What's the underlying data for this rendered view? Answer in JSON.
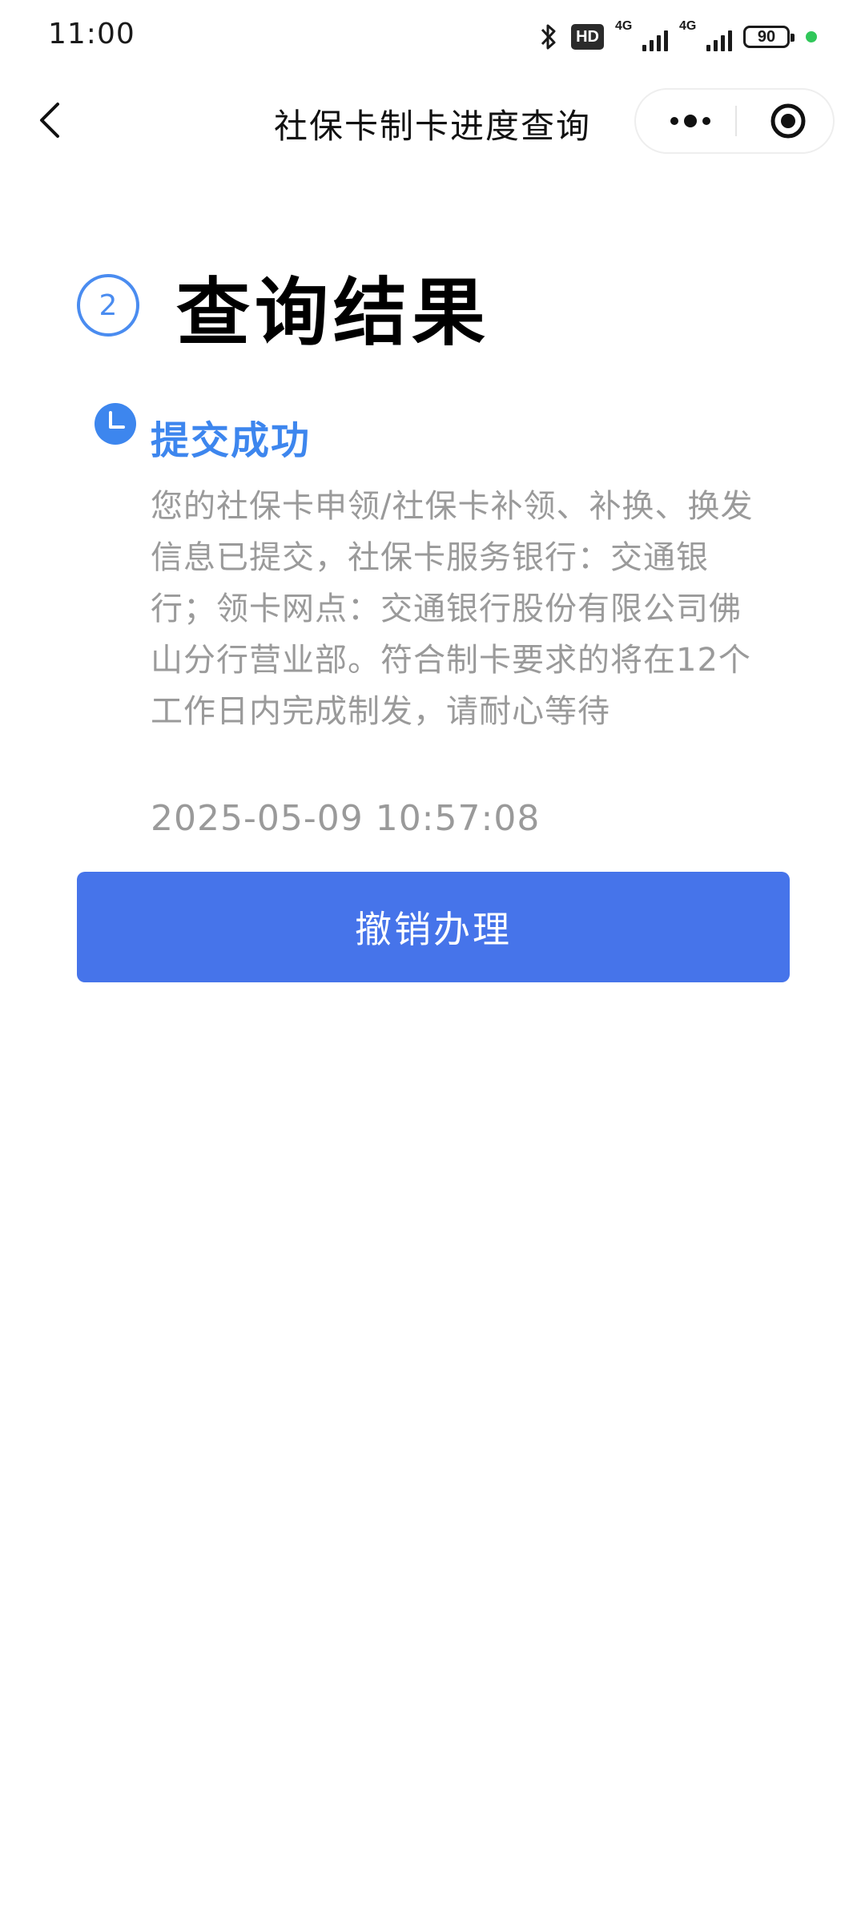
{
  "status_bar": {
    "time": "11:00",
    "network_1": "4G",
    "network_2": "4G",
    "hd_label": "HD",
    "battery": "90",
    "icons": [
      "bluetooth-icon",
      "hd-icon",
      "signal-icon",
      "battery-icon"
    ],
    "indicator_color": "#31c75a"
  },
  "nav": {
    "title": "社保卡制卡进度查询",
    "icons": [
      "back-arrow-icon",
      "more-dots-icon",
      "close-target-icon"
    ]
  },
  "result": {
    "step_number": "2",
    "title": "查询结果"
  },
  "timeline": {
    "status_label": "提交成功",
    "description": "您的社保卡申领/社保卡补领、补换、换发信息已提交，社保卡服务银行：交通银行；领卡网点：交通银行股份有限公司佛山分行营业部。符合制卡要求的将在12个工作日内完成制发，请耐心等待",
    "timestamp": "2025-05-09 10:57:08",
    "icon": "clock-icon"
  },
  "actions": {
    "cancel_label": "撤销办理"
  },
  "colors": {
    "accent": "#3d86ee",
    "button": "#4674ea",
    "muted_text": "#9a9a9a"
  }
}
